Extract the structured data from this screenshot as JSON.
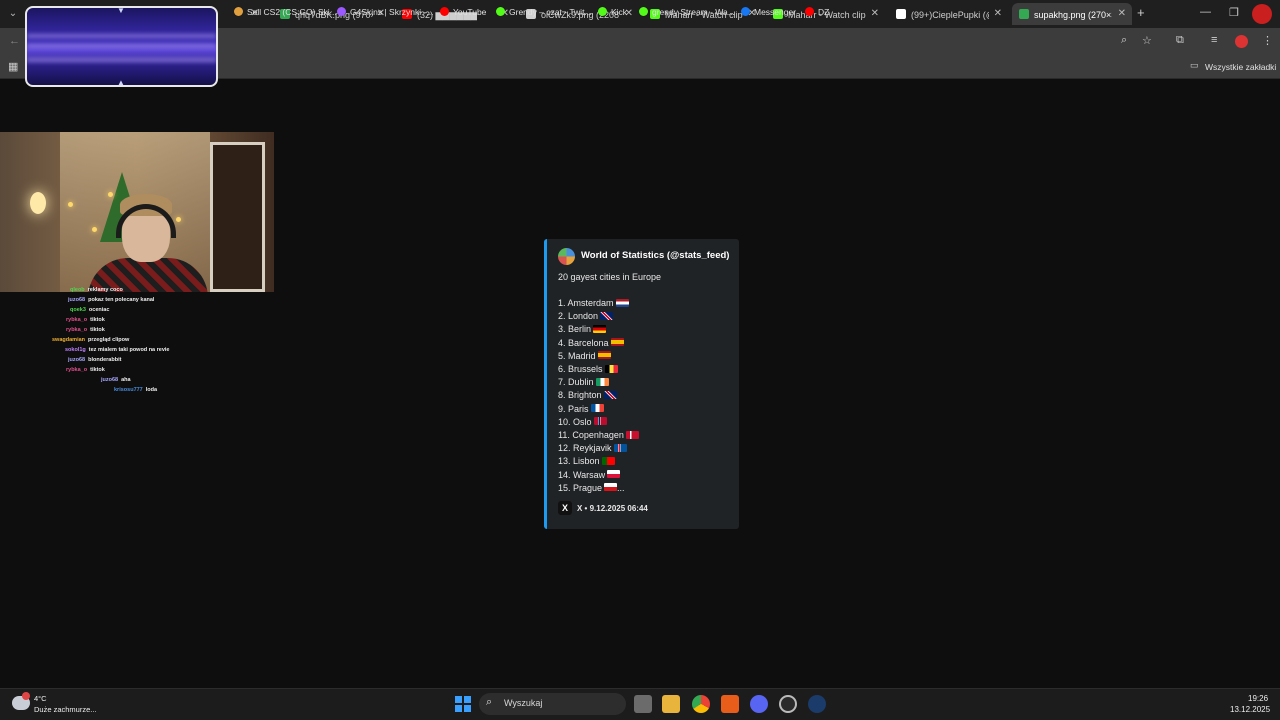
{
  "browser": {
    "tabs": [
      {
        "label": "YouTube",
        "favicon": "youtube-icon",
        "color": "#ff0000"
      },
      {
        "label": "qhqTdBK.png (970×5",
        "favicon": "image-icon",
        "color": "#34a853"
      },
      {
        "label": "(32) ▆▆▆▆▆▆",
        "favicon": "youtube-icon",
        "color": "#ff0000"
      },
      {
        "label": "oiCwZk9.png (2208×",
        "favicon": "image-icon",
        "color": "#cfcfcf"
      },
      {
        "label": "Maharr - Watch clips",
        "favicon": "kick-icon",
        "color": "#53fc18"
      },
      {
        "label": "Maharr - Watch clips",
        "favicon": "kick-icon",
        "color": "#53fc18"
      },
      {
        "label": "(99+)CieplePupki (@",
        "favicon": "tiktok-icon",
        "color": "#ffffff"
      },
      {
        "label": "supakhg.png (270×3",
        "favicon": "image-icon",
        "color": "#34a853",
        "active": true
      }
    ],
    "new_tab": "+",
    "bookmarks": [
      {
        "label": "Sell CS2 (CS:GO) Ski...",
        "color": "#e0a040"
      },
      {
        "label": "G4Skins | Skrzynki -...",
        "color": "#9b59ff"
      },
      {
        "label": "YouTube",
        "color": "#ff0000"
      },
      {
        "label": "Grendy – czat - Twit...",
        "color": "#53fc18"
      },
      {
        "label": "Kick",
        "color": "#53fc18"
      },
      {
        "label": "grendy Stream - Wa...",
        "color": "#53fc18"
      },
      {
        "label": "Messenger",
        "color": "#1877f2"
      },
      {
        "label": "DZ",
        "color": "#ff0000"
      }
    ],
    "all_bookmarks": "Wszystkie zakładki"
  },
  "chat": [
    {
      "user": "qleob",
      "msg": "reklamy coco",
      "color": "#4fd84f"
    },
    {
      "user": "juzo68",
      "msg": "pokaz ten polecany kanal",
      "color": "#a8a8ff"
    },
    {
      "user": "qoek3",
      "msg": "oceniac",
      "color": "#4fd84f"
    },
    {
      "user": "rybka_o",
      "msg": "tiktok",
      "color": "#e0508a"
    },
    {
      "user": "rybka_o",
      "msg": "tiktok",
      "color": "#e0508a"
    },
    {
      "user": "swagdamian",
      "msg": "przegląd clipow",
      "color": "#f0b030"
    },
    {
      "user": "sokol1g",
      "msg": "tez mialem taki powod na revie",
      "color": "#c080ff"
    },
    {
      "user": "juzo68",
      "msg": "blonderabbit",
      "color": "#a8a8ff"
    },
    {
      "user": "rybka_o",
      "msg": "tiktok",
      "color": "#e0508a"
    },
    {
      "user": "juzo68",
      "msg": "aha",
      "color": "#a8a8ff"
    },
    {
      "user": "krisosu777",
      "msg": "loda",
      "color": "#4a8fe0"
    }
  ],
  "tweet": {
    "author": "World of Statistics (@stats_feed)",
    "headline": "20 gayest cities in Europe",
    "items": [
      {
        "text": "1. Amsterdam",
        "flag": "nl"
      },
      {
        "text": "2. London",
        "flag": "gb"
      },
      {
        "text": "3. Berlin",
        "flag": "de"
      },
      {
        "text": "4. Barcelona",
        "flag": "es"
      },
      {
        "text": "5. Madrid",
        "flag": "es"
      },
      {
        "text": "6. Brussels",
        "flag": "be"
      },
      {
        "text": "7. Dublin",
        "flag": "ie"
      },
      {
        "text": "8. Brighton",
        "flag": "gb"
      },
      {
        "text": "9. Paris",
        "flag": "fr"
      },
      {
        "text": "10. Oslo",
        "flag": "no"
      },
      {
        "text": "11. Copenhagen",
        "flag": "dk"
      },
      {
        "text": "12. Reykjavik",
        "flag": "is"
      },
      {
        "text": "13. Lisbon",
        "flag": "pt"
      },
      {
        "text": "14. Warsaw",
        "flag": "pl"
      },
      {
        "text": "15. Prague",
        "flag": "cz"
      }
    ],
    "ellipsis": "...",
    "footer": "X • 9.12.2025 06:44",
    "accent": "#1d9bf0"
  },
  "taskbar": {
    "weather_temp": "4°C",
    "weather_desc": "Duże zachmurze...",
    "search_placeholder": "Wyszukaj",
    "time": "19:26",
    "date": "13.12.2025"
  }
}
